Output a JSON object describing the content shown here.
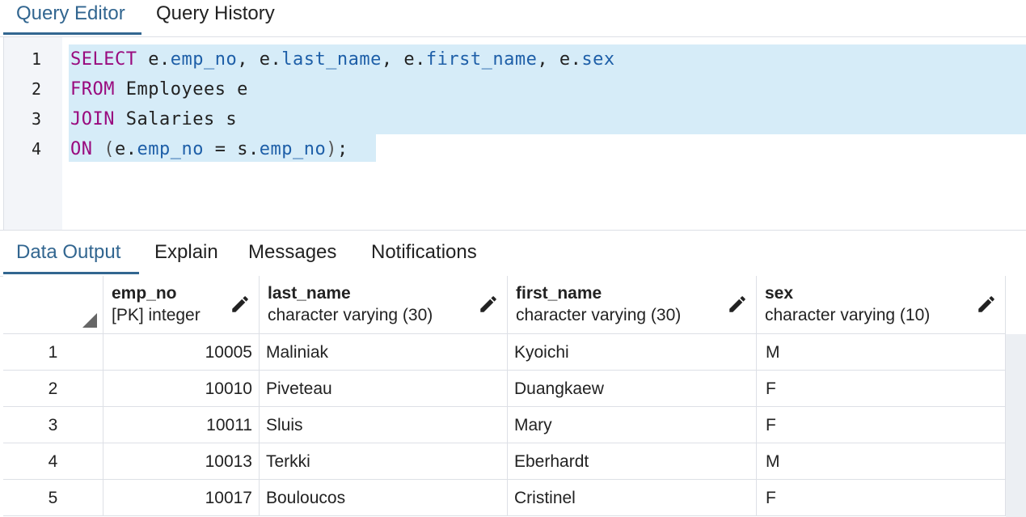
{
  "top_tabs": [
    {
      "label": "Query Editor",
      "active": true
    },
    {
      "label": "Query History",
      "active": false
    }
  ],
  "editor": {
    "line_numbers": [
      "1",
      "2",
      "3",
      "4"
    ]
  },
  "bottom_tabs": [
    {
      "label": "Data Output",
      "active": true
    },
    {
      "label": "Explain",
      "active": false
    },
    {
      "label": "Messages",
      "active": false
    },
    {
      "label": "Notifications",
      "active": false
    }
  ],
  "grid": {
    "columns": [
      {
        "name": "emp_no",
        "type": "[PK] integer"
      },
      {
        "name": "last_name",
        "type": "character varying (30)"
      },
      {
        "name": "first_name",
        "type": "character varying (30)"
      },
      {
        "name": "sex",
        "type": "character varying (10)"
      }
    ],
    "rows": [
      {
        "rownum": "1",
        "emp_no": "10005",
        "last_name": "Maliniak",
        "first_name": "Kyoichi",
        "sex": "M"
      },
      {
        "rownum": "2",
        "emp_no": "10010",
        "last_name": "Piveteau",
        "first_name": "Duangkaew",
        "sex": "F"
      },
      {
        "rownum": "3",
        "emp_no": "10011",
        "last_name": "Sluis",
        "first_name": "Mary",
        "sex": "F"
      },
      {
        "rownum": "4",
        "emp_no": "10013",
        "last_name": "Terkki",
        "first_name": "Eberhardt",
        "sex": "M"
      },
      {
        "rownum": "5",
        "emp_no": "10017",
        "last_name": "Bouloucos",
        "first_name": "Cristinel",
        "sex": "F"
      }
    ]
  },
  "colors": {
    "accent": "#326690",
    "keyword": "#990a7e",
    "field": "#1e5fa8",
    "selection": "#d6ecf8",
    "gutter": "#f3f5f9"
  }
}
